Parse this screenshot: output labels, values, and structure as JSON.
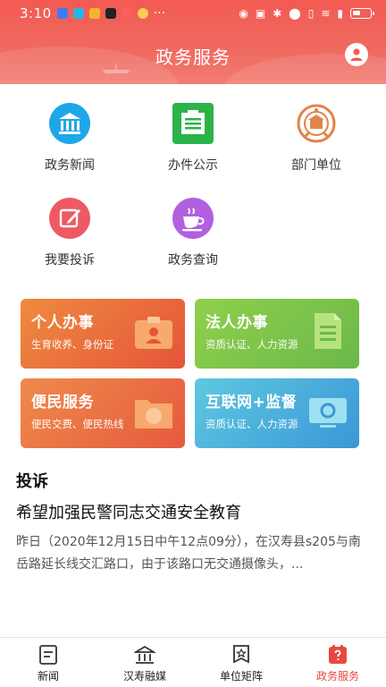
{
  "status_bar": {
    "time": "3:10",
    "more": "···"
  },
  "header": {
    "title": "政务服务"
  },
  "grid": [
    {
      "label": "政务新闻",
      "icon": "bank-building-icon"
    },
    {
      "label": "办件公示",
      "icon": "notice-board-icon"
    },
    {
      "label": "部门单位",
      "icon": "national-emblem-icon"
    },
    {
      "label": "我要投诉",
      "icon": "edit-pencil-icon"
    },
    {
      "label": "政务查询",
      "icon": "coffee-cup-icon"
    }
  ],
  "cards": [
    {
      "title": "个人办事",
      "subtitle": "生育收养、身份证",
      "icon": "id-card-icon",
      "color": "#e8593a"
    },
    {
      "title": "法人办事",
      "subtitle": "资质认证、人力资源",
      "icon": "document-icon",
      "color": "#7fc24a"
    },
    {
      "title": "便民服务",
      "subtitle": "便民交费、便民热线",
      "icon": "compass-folder-icon",
      "color": "#ea6f47"
    },
    {
      "title": "互联网+监督",
      "subtitle": "资质认证、人力资源",
      "icon": "monitor-icon",
      "color": "#3aa6d6"
    }
  ],
  "complaint": {
    "section_title": "投诉",
    "title": "希望加强民警同志交通安全教育",
    "text": "昨日（2020年12月15日中午12点09分），在汉寿县s205与南岳路延长线交汇路口，由于该路口无交通摄像头，..."
  },
  "tabs": [
    {
      "label": "新闻",
      "icon": "news-icon",
      "active": false
    },
    {
      "label": "汉寿融媒",
      "icon": "building-icon",
      "active": false
    },
    {
      "label": "单位矩阵",
      "icon": "star-badge-icon",
      "active": false
    },
    {
      "label": "政务服务",
      "icon": "question-service-icon",
      "active": true
    }
  ],
  "colors": {
    "header": "#f25a52",
    "accent": "#e8473f"
  }
}
